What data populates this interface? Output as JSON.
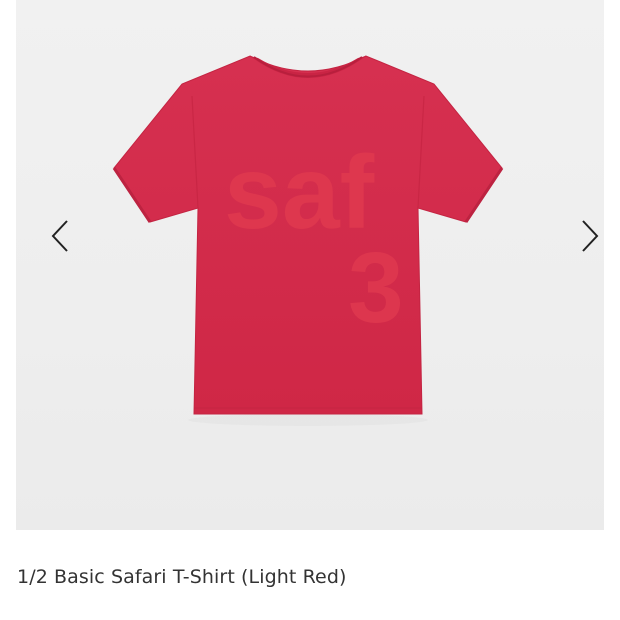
{
  "product": {
    "title": "1/2 Basic Safari T-Shirt (Light Red)",
    "image": {
      "subject": "t-shirt",
      "shirt_color": "#d42a4a",
      "print_text_line1": "saf",
      "print_text_line2": "3",
      "print_color": "#e0394f"
    }
  },
  "gallery": {
    "background": "#efefef",
    "prev_icon": "chevron-left-icon",
    "next_icon": "chevron-right-icon"
  }
}
